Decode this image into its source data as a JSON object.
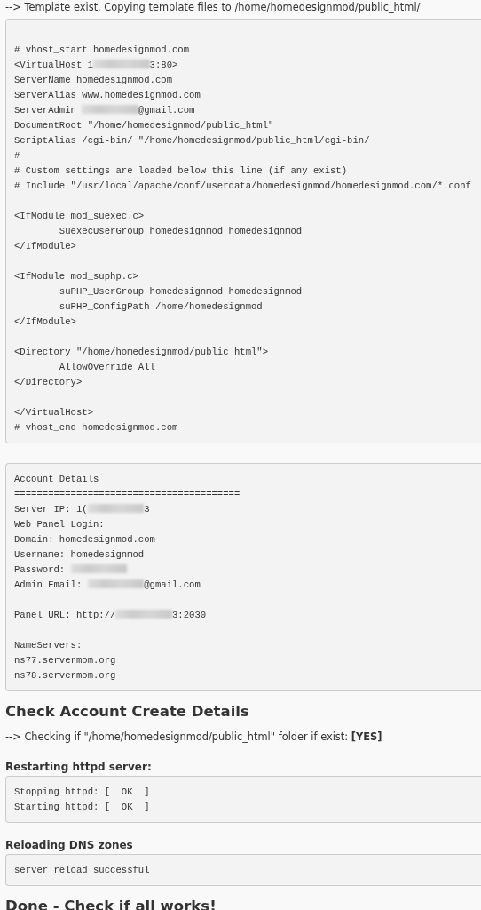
{
  "content": [
    {
      "kind": "text",
      "text": "--> Template exist. Copying template files to /home/homedesignmod/public_html/"
    },
    {
      "kind": "code",
      "lead_blank": true,
      "groups": [
        [
          "# vhost_start homedesignmod.com",
          [
            {
              "kind": "text",
              "text": "<VirtualHost 1"
            },
            {
              "kind": "blur"
            },
            {
              "kind": "text",
              "text": "3:80>"
            }
          ],
          "ServerName homedesignmod.com",
          "ServerAlias www.homedesignmod.com",
          [
            {
              "kind": "text",
              "text": "ServerAdmin "
            },
            {
              "kind": "blur"
            },
            {
              "kind": "text",
              "text": "@gmail.com"
            }
          ],
          "DocumentRoot \"/home/homedesignmod/public_html\"",
          "ScriptAlias /cgi-bin/ \"/home/homedesignmod/public_html/cgi-bin/",
          "#",
          "# Custom settings are loaded below this line (if any exist)",
          "# Include \"/usr/local/apache/conf/userdata/homedesignmod/homedesignmod.com/*.conf"
        ],
        [
          "<IfModule mod_suexec.c>",
          "        SuexecUserGroup homedesignmod homedesignmod",
          "</IfModule>"
        ],
        [
          "<IfModule mod_suphp.c>",
          "        suPHP_UserGroup homedesignmod homedesignmod",
          "        suPHP_ConfigPath /home/homedesignmod",
          "</IfModule>"
        ],
        [
          "<Directory \"/home/homedesignmod/public_html\">",
          "        AllowOverride All",
          "</Directory>"
        ],
        [
          "</VirtualHost>",
          "# vhost_end homedesignmod.com"
        ]
      ]
    },
    {
      "kind": "code",
      "lead_blank": false,
      "groups": [
        [
          "Account Details",
          "========================================",
          [
            {
              "kind": "text",
              "text": "Server IP: 1("
            },
            {
              "kind": "blur"
            },
            {
              "kind": "text",
              "text": "3"
            }
          ],
          "Web Panel Login:",
          "Domain: homedesignmod.com",
          "Username: homedesignmod",
          [
            {
              "kind": "text",
              "text": "Password: "
            },
            {
              "kind": "blur"
            }
          ],
          [
            {
              "kind": "text",
              "text": "Admin Email: "
            },
            {
              "kind": "blur"
            },
            {
              "kind": "text",
              "text": "@gmail.com"
            }
          ]
        ],
        [
          [
            {
              "kind": "text",
              "text": "Panel URL: http://"
            },
            {
              "kind": "blur"
            },
            {
              "kind": "text",
              "text": "3:2030"
            }
          ]
        ],
        [
          "NameServers:",
          "ns77.servermom.org",
          "ns78.servermom.org"
        ]
      ]
    },
    {
      "kind": "heading",
      "text": "Check Account Create Details"
    },
    {
      "kind": "text",
      "text": "--> Checking if \"/home/homedesignmod/public_html\" folder if exist: **[YES]**"
    },
    {
      "kind": "subheading",
      "text": "Restarting httpd server:"
    },
    {
      "kind": "code",
      "lead_blank": false,
      "groups": [
        [
          "Stopping httpd: [  OK  ]",
          "Starting httpd: [  OK  ]"
        ]
      ]
    },
    {
      "kind": "subheading",
      "text": "Reloading DNS zones"
    },
    {
      "kind": "code",
      "lead_blank": false,
      "groups": [
        [
          "server reload successful"
        ]
      ]
    },
    {
      "kind": "heading",
      "text": "Done - Check if all works!"
    }
  ]
}
